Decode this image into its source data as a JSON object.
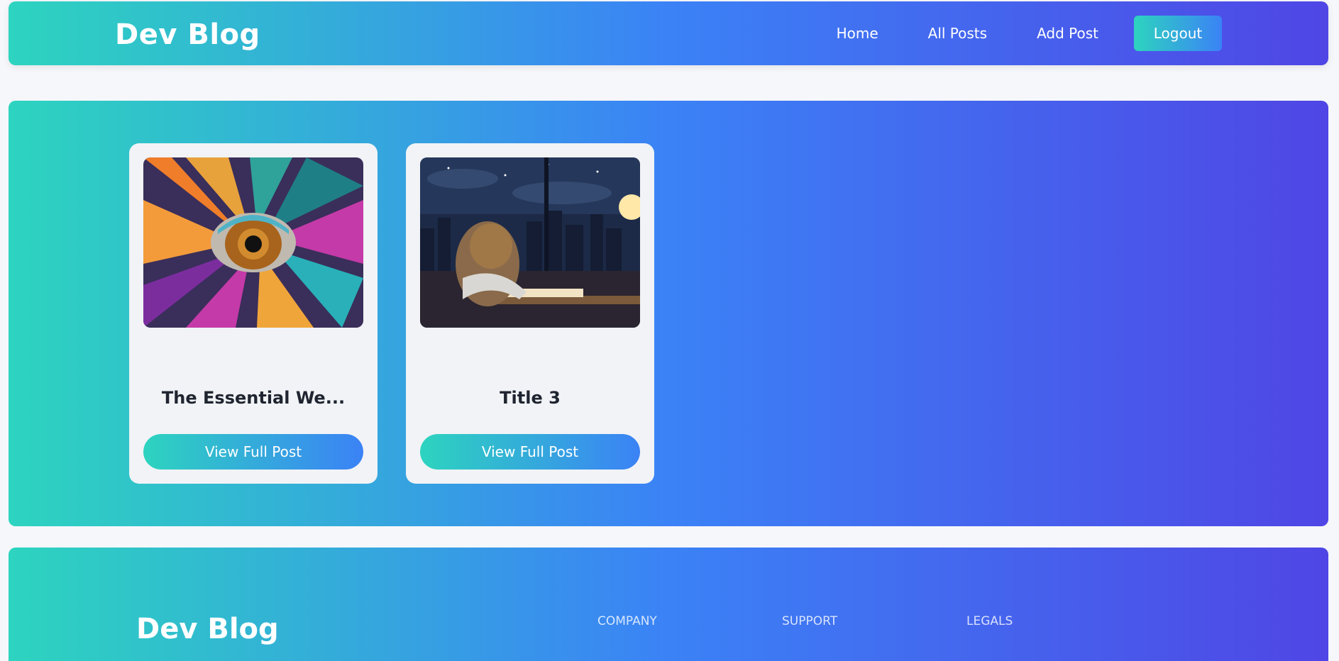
{
  "nav": {
    "brand": "Dev Blog",
    "links": [
      "Home",
      "All Posts",
      "Add Post"
    ],
    "logout": "Logout"
  },
  "posts": [
    {
      "title": "The Essential We...",
      "button": "View Full Post",
      "image": "abstract-eye-painting"
    },
    {
      "title": "Title 3",
      "button": "View Full Post",
      "image": "anime-girl-studying-at-night"
    }
  ],
  "footer": {
    "brand": "Dev Blog",
    "headings": [
      "COMPANY",
      "SUPPORT",
      "LEGALS"
    ]
  },
  "colors": {
    "gradient_start": "#2dd4bf",
    "gradient_mid": "#3b82f6",
    "gradient_end": "#4f46e5",
    "card_bg": "#f1f3f6",
    "page_bg": "#f6f7fa"
  }
}
